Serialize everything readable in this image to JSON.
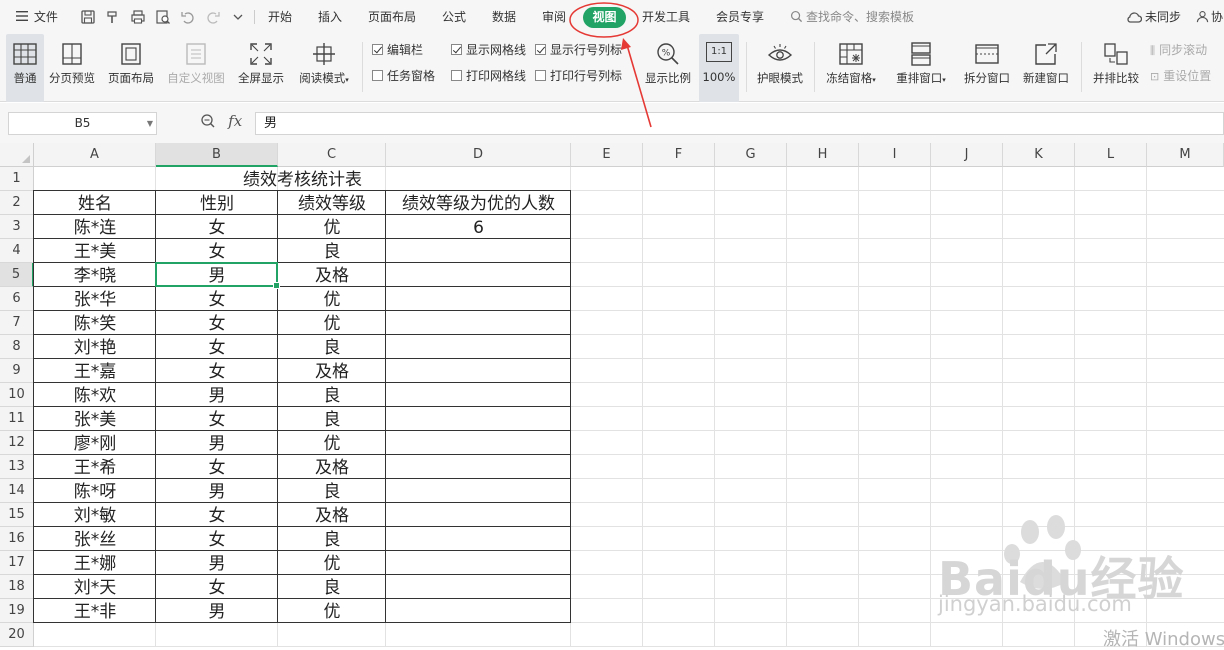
{
  "menu": {
    "file_label": "文件",
    "tabs": [
      "开始",
      "插入",
      "页面布局",
      "公式",
      "数据",
      "审阅",
      "视图",
      "开发工具",
      "会员专享"
    ],
    "active_tab": "视图",
    "search_placeholder": "查找命令、搜索模板",
    "sync_label": "未同步",
    "collab_label": "协"
  },
  "ribbon": {
    "normal": "普通",
    "page_break_preview": "分页预览",
    "page_layout": "页面布局",
    "custom_view": "自定义视图",
    "full_screen": "全屏显示",
    "reading_mode": "阅读模式",
    "chk_formula_bar": "编辑栏",
    "chk_gridlines": "显示网格线",
    "chk_headings": "显示行号列标",
    "chk_task_pane": "任务窗格",
    "chk_print_gridlines": "打印网格线",
    "chk_print_headings": "打印行号列标",
    "zoom": "显示比例",
    "zoom100_icon_text": "1:1",
    "zoom100": "100%",
    "eye_protection": "护眼模式",
    "freeze": "冻结窗格",
    "arrange": "重排窗口",
    "split": "拆分窗口",
    "new_window": "新建窗口",
    "side_by_side": "并排比较",
    "sync_scroll": "同步滚动",
    "reset_position": "重设位置"
  },
  "formula_bar": {
    "cell_ref": "B5",
    "fx_label": "fx",
    "content": "男"
  },
  "sheet": {
    "columns": [
      "A",
      "B",
      "C",
      "D",
      "E",
      "F",
      "G",
      "H",
      "I",
      "J",
      "K",
      "L",
      "M"
    ],
    "rows": [
      "1",
      "2",
      "3",
      "4",
      "5",
      "6",
      "7",
      "8",
      "9",
      "10",
      "11",
      "12",
      "13",
      "14",
      "15",
      "16",
      "17",
      "18",
      "19",
      "20"
    ],
    "title": "绩效考核统计表",
    "headers": [
      "姓名",
      "性别",
      "绩效等级",
      "绩效等级为优的人数"
    ],
    "records": [
      [
        "陈*连",
        "女",
        "优",
        "6"
      ],
      [
        "王*美",
        "女",
        "良",
        ""
      ],
      [
        "李*晓",
        "男",
        "及格",
        ""
      ],
      [
        "张*华",
        "女",
        "优",
        ""
      ],
      [
        "陈*笑",
        "女",
        "优",
        ""
      ],
      [
        "刘*艳",
        "女",
        "良",
        ""
      ],
      [
        "王*嘉",
        "女",
        "及格",
        ""
      ],
      [
        "陈*欢",
        "男",
        "良",
        ""
      ],
      [
        "张*美",
        "女",
        "良",
        ""
      ],
      [
        "廖*刚",
        "男",
        "优",
        ""
      ],
      [
        "王*希",
        "女",
        "及格",
        ""
      ],
      [
        "陈*呀",
        "男",
        "良",
        ""
      ],
      [
        "刘*敏",
        "女",
        "及格",
        ""
      ],
      [
        "张*丝",
        "女",
        "良",
        ""
      ],
      [
        "王*娜",
        "男",
        "优",
        ""
      ],
      [
        "刘*天",
        "女",
        "良",
        ""
      ],
      [
        "王*非",
        "男",
        "优",
        ""
      ]
    ]
  },
  "watermark": {
    "brand": "Baidu经验",
    "url": "jingyan.baidu.com"
  },
  "activate_windows": "激活 Windows",
  "colors": {
    "accent": "#21a366",
    "annotation": "#e53935"
  }
}
